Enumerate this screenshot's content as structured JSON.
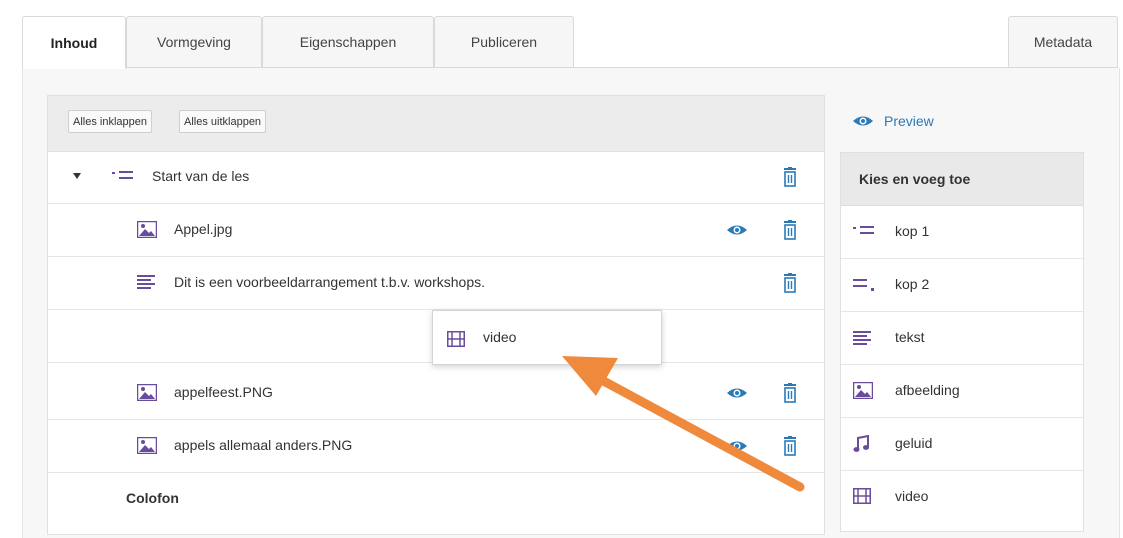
{
  "tabs": {
    "inhoud": "Inhoud",
    "vormgeving": "Vormgeving",
    "eigenschappen": "Eigenschappen",
    "publiceren": "Publiceren",
    "metadata": "Metadata"
  },
  "tree": {
    "collapse_all": "Alles inklappen",
    "expand_all": "Alles uitklappen",
    "rows": [
      {
        "label": "Start van de les",
        "icon": "heading-icon",
        "eye": false
      },
      {
        "label": "Appel.jpg",
        "icon": "image-icon",
        "eye": true
      },
      {
        "label": "Dit is een voorbeeldarrangement t.b.v. workshops.",
        "icon": "text-icon",
        "eye": false
      },
      {
        "label": "appelfeest.PNG",
        "icon": "image-icon",
        "eye": true
      },
      {
        "label": "appels allemaal anders.PNG",
        "icon": "image-icon",
        "eye": true
      },
      {
        "label": "Colofon"
      }
    ],
    "drag_item": "video"
  },
  "side": {
    "preview": "Preview",
    "palette_title": "Kies en voeg toe",
    "items": [
      {
        "label": "kop 1",
        "icon": "heading1-icon"
      },
      {
        "label": "kop 2",
        "icon": "heading2-icon"
      },
      {
        "label": "tekst",
        "icon": "text-icon"
      },
      {
        "label": "afbeelding",
        "icon": "image-icon"
      },
      {
        "label": "geluid",
        "icon": "music-icon"
      },
      {
        "label": "video",
        "icon": "film-icon"
      }
    ]
  },
  "colors": {
    "accent": "#2a7ab8",
    "icon_purple": "#6a4c9c",
    "arrow": "#ef8a3c"
  }
}
